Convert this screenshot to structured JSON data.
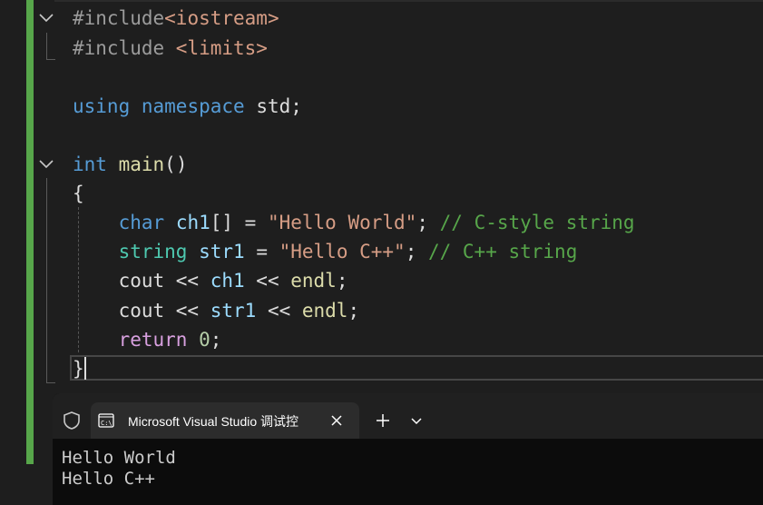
{
  "editor": {
    "lines": [
      {
        "tokens": [
          {
            "t": "#include",
            "c": "pp"
          },
          {
            "t": "<iostream>",
            "c": "inc"
          }
        ]
      },
      {
        "tokens": [
          {
            "t": "#include ",
            "c": "pp"
          },
          {
            "t": "<limits>",
            "c": "inc"
          }
        ]
      },
      {
        "tokens": []
      },
      {
        "tokens": [
          {
            "t": "using",
            "c": "kw"
          },
          {
            "t": " ",
            "c": "br"
          },
          {
            "t": "namespace",
            "c": "kw"
          },
          {
            "t": " std;",
            "c": "br"
          }
        ]
      },
      {
        "tokens": []
      },
      {
        "tokens": [
          {
            "t": "int",
            "c": "kw"
          },
          {
            "t": " ",
            "c": "br"
          },
          {
            "t": "main",
            "c": "fn"
          },
          {
            "t": "()",
            "c": "br"
          }
        ]
      },
      {
        "tokens": [
          {
            "t": "{",
            "c": "br"
          }
        ]
      },
      {
        "tokens": [
          {
            "t": "    ",
            "c": "br"
          },
          {
            "t": "char",
            "c": "kw"
          },
          {
            "t": " ",
            "c": "br"
          },
          {
            "t": "ch1",
            "c": "var"
          },
          {
            "t": "[] = ",
            "c": "br"
          },
          {
            "t": "\"Hello World\"",
            "c": "str"
          },
          {
            "t": "; ",
            "c": "br"
          },
          {
            "t": "// C-style string",
            "c": "cm"
          }
        ]
      },
      {
        "tokens": [
          {
            "t": "    ",
            "c": "br"
          },
          {
            "t": "string",
            "c": "ty"
          },
          {
            "t": " ",
            "c": "br"
          },
          {
            "t": "str1",
            "c": "var"
          },
          {
            "t": " = ",
            "c": "br"
          },
          {
            "t": "\"Hello C++\"",
            "c": "str"
          },
          {
            "t": "; ",
            "c": "br"
          },
          {
            "t": "// C++ string",
            "c": "cm"
          }
        ]
      },
      {
        "tokens": [
          {
            "t": "    cout << ",
            "c": "br"
          },
          {
            "t": "ch1",
            "c": "var"
          },
          {
            "t": " << ",
            "c": "br"
          },
          {
            "t": "endl",
            "c": "fn"
          },
          {
            "t": ";",
            "c": "br"
          }
        ]
      },
      {
        "tokens": [
          {
            "t": "    cout << ",
            "c": "br"
          },
          {
            "t": "str1",
            "c": "var"
          },
          {
            "t": " << ",
            "c": "br"
          },
          {
            "t": "endl",
            "c": "fn"
          },
          {
            "t": ";",
            "c": "br"
          }
        ]
      },
      {
        "tokens": [
          {
            "t": "    ",
            "c": "br"
          },
          {
            "t": "return",
            "c": "ctl"
          },
          {
            "t": " ",
            "c": "br"
          },
          {
            "t": "0",
            "c": "num"
          },
          {
            "t": ";",
            "c": "br"
          }
        ]
      },
      {
        "tokens": [
          {
            "t": "}",
            "c": "br"
          }
        ]
      }
    ],
    "colors": {
      "background": "#1e1e1e",
      "change_bar": "#57a64a",
      "keyword": "#569cd6",
      "type": "#4ec9b0",
      "function": "#dcdcaa",
      "string": "#d69d85",
      "comment": "#57a64a",
      "control": "#d8a0df",
      "number": "#b5cea8",
      "variable": "#9cdcfe"
    },
    "fold_icons": [
      "chevron-down-icon",
      "chevron-down-icon"
    ]
  },
  "terminal": {
    "tab": {
      "icon": "console-icon",
      "title": "Microsoft Visual Studio 调试控",
      "close_icon": "close-icon"
    },
    "shield_icon": "shield-icon",
    "new_tab_icon": "plus-icon",
    "dropdown_icon": "chevron-down-icon",
    "output": [
      "Hello World",
      "Hello C++"
    ]
  }
}
